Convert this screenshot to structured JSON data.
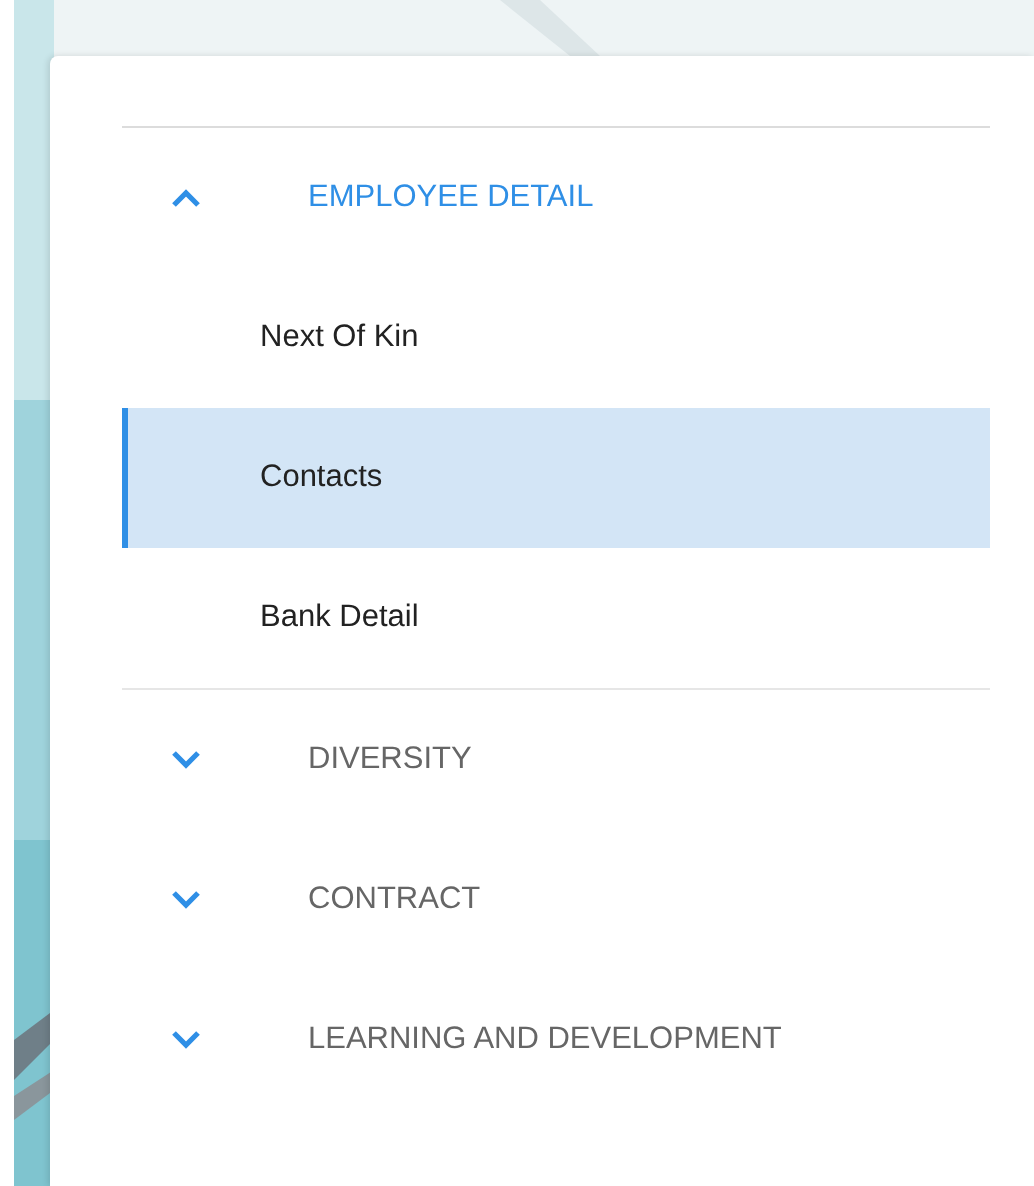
{
  "sections": [
    {
      "title": "EMPLOYEE DETAIL",
      "expanded": true,
      "children": [
        {
          "label": "Next Of Kin",
          "selected": false
        },
        {
          "label": "Contacts",
          "selected": true
        },
        {
          "label": "Bank Detail",
          "selected": false
        }
      ]
    },
    {
      "title": "DIVERSITY",
      "expanded": false
    },
    {
      "title": "CONTRACT",
      "expanded": false
    },
    {
      "title": "LEARNING AND DEVELOPMENT",
      "expanded": false
    }
  ]
}
